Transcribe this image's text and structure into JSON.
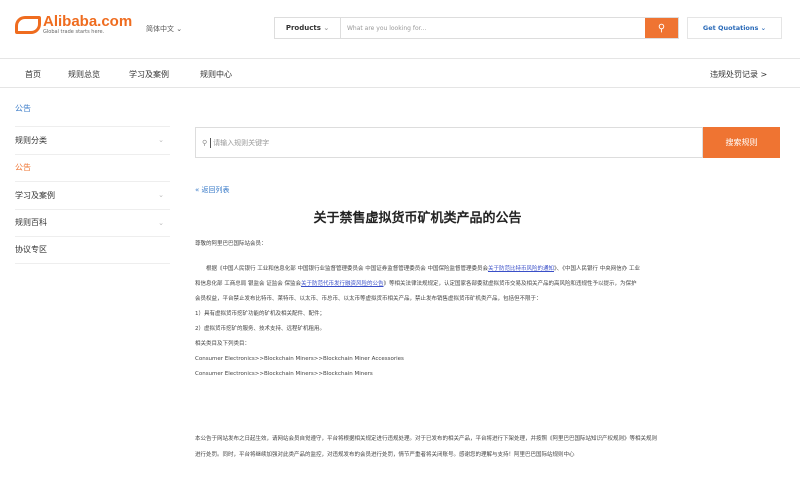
{
  "header": {
    "logo_text": "Alibaba.com",
    "logo_tagline": "Global trade starts here.",
    "language": "简体中文",
    "search_category": "Products",
    "search_placeholder": "What are you looking for...",
    "quotations": "Get Quotations"
  },
  "nav": {
    "items": [
      "首页",
      "规则总览",
      "学习及案例",
      "规则中心"
    ],
    "right": "违规处罚记录 >"
  },
  "breadcrumb": "公告",
  "sidebar": [
    {
      "label": "规则分类",
      "chevron": true
    },
    {
      "label": "公告",
      "active": true
    },
    {
      "label": "学习及案例",
      "chevron": true
    },
    {
      "label": "规则百科",
      "chevron": true
    },
    {
      "label": "协议专区"
    }
  ],
  "rule_search": {
    "placeholder": "请输入规则关键字",
    "button": "搜索规则"
  },
  "article": {
    "back": "« 返回列表",
    "title": "关于禁售虚拟货币矿机类产品的公告",
    "greeting": "尊敬的阿里巴巴国际站会员：",
    "p1_a": "根据《中国人民银行 工业和信息化部 中国银行业监督管理委员会 中国证券监督管理委员会 中国保险监督管理委员会",
    "p1_link1": "关于防范比特币风险的通知",
    "p1_b": "》、《中国人民银行 中央网信办 工业和信息化部 工商总局 银监会 证监会 保监会",
    "p1_link2": "关于防范代币发行融资风险的公告",
    "p1_c": "》等相关法律法规规定，认定国家各部委就虚拟货币交易及相关产品的高风险和违规性予以提示，为保护会员权益，平台禁止发布比特币、莱特币、以太币、币总币、以太币等虚拟货币相关产品，禁止发布销售虚拟货币矿机类产品，包括但不限于：",
    "list": [
      "1）具有虚拟货币挖矿功能的矿机及相关配件、配件；",
      "2）虚拟货币挖矿的服务、技术支持、远程矿机租用。"
    ],
    "category_intro": "相关类目及下列类目：",
    "categories": [
      "Consumer Electronics>>Blockchain Miners>>Blockchain Miner Accessories",
      "Consumer Electronics>>Blockchain Miners>>Blockchain Miners"
    ],
    "p2": "本公告于网站发布之日起生效，请网站会员自觉遵守，平台将根据相关规定进行违规处理。对于已发布的相关产品，平台将进行下架处理，并按照《阿里巴巴国际站知识产权规则》等相关规则进行处罚。同时，平台将继续加强对此类产品的监控，对违规发布的会员进行处罚，情节严重者将关闭账号。感谢您的理解与支持！阿里巴巴国际站规则中心"
  }
}
